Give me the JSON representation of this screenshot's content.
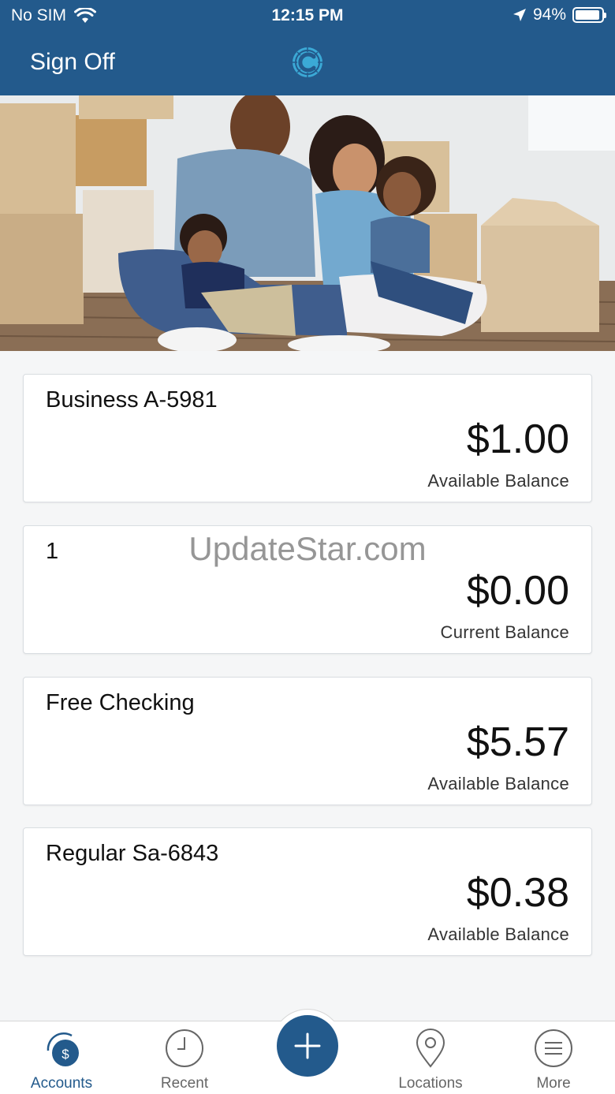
{
  "status_bar": {
    "carrier": "No SIM",
    "time": "12:15 PM",
    "battery": "94%",
    "battery_level": 0.94
  },
  "header": {
    "sign_off_label": "Sign Off",
    "logo_icon": "bank-logo-icon"
  },
  "hero": {
    "icon": "family-photo"
  },
  "accounts": [
    {
      "name": "Business A-5981",
      "amount": "$1.00",
      "balance_label": "Available Balance"
    },
    {
      "name": "1",
      "amount": "$0.00",
      "balance_label": "Current Balance"
    },
    {
      "name": "Free Checking",
      "amount": "$5.57",
      "balance_label": "Available Balance"
    },
    {
      "name": "Regular Sa-6843",
      "amount": "$0.38",
      "balance_label": "Available Balance"
    }
  ],
  "watermark": "UpdateStar.com",
  "tab_bar": {
    "tabs": [
      {
        "label": "Accounts",
        "icon": "accounts-icon"
      },
      {
        "label": "Recent",
        "icon": "clock-icon"
      },
      {
        "label": "Locations",
        "icon": "location-pin-icon"
      },
      {
        "label": "More",
        "icon": "menu-icon"
      }
    ],
    "fab_icon": "plus-icon"
  },
  "colors": {
    "brand": "#235a8c",
    "background": "#f5f6f7",
    "card": "#ffffff"
  }
}
